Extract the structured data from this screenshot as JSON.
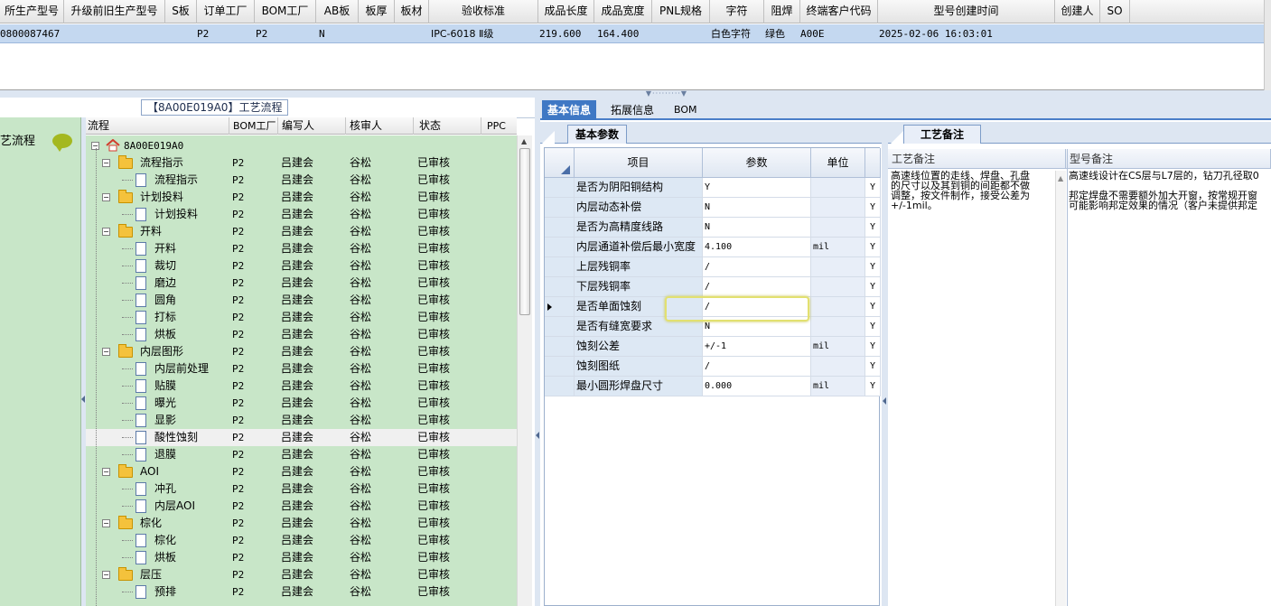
{
  "top_grid": {
    "columns": [
      "所生产型号",
      "升级前旧生产型号",
      "S板",
      "订单工厂",
      "BOM工厂",
      "AB板",
      "板厚",
      "板材",
      "验收标准",
      "成品长度",
      "成品宽度",
      "PNL规格",
      "字符",
      "阻焊",
      "终端客户代码",
      "型号创建时间",
      "创建人",
      "SO"
    ],
    "row": {
      "model": "0800087467",
      "old_model": "",
      "s_board": "",
      "order_factory": "P2",
      "bom_factory": "P2",
      "ab": "N",
      "thickness": "",
      "material": "",
      "standard": "IPC-6018 Ⅱ级",
      "length": "219.600",
      "width": "164.400",
      "pnl": "",
      "char": "白色字符",
      "mask": "绿色",
      "customer": "A00E",
      "created": "2025-02-06 16:03:01",
      "creator": "",
      "so": ""
    }
  },
  "left": {
    "title": "【8A00E019A0】工艺流程",
    "side_label": "艺流程",
    "tree_headers": [
      "流程",
      "BOM工厂",
      "编写人",
      "核审人",
      "状态",
      "PPC"
    ],
    "root": "8A00E019A0",
    "rows": [
      {
        "name": "流程指示",
        "level": 1,
        "type": "folder",
        "bom": "P2",
        "writer": "吕建会",
        "reviewer": "谷松",
        "status": "已审核"
      },
      {
        "name": "流程指示",
        "level": 2,
        "type": "doc",
        "bom": "P2",
        "writer": "吕建会",
        "reviewer": "谷松",
        "status": "已审核"
      },
      {
        "name": "计划投料",
        "level": 1,
        "type": "folder",
        "bom": "P2",
        "writer": "吕建会",
        "reviewer": "谷松",
        "status": "已审核"
      },
      {
        "name": "计划投料",
        "level": 2,
        "type": "doc",
        "bom": "P2",
        "writer": "吕建会",
        "reviewer": "谷松",
        "status": "已审核"
      },
      {
        "name": "开料",
        "level": 1,
        "type": "folder",
        "bom": "P2",
        "writer": "吕建会",
        "reviewer": "谷松",
        "status": "已审核"
      },
      {
        "name": "开料",
        "level": 2,
        "type": "doc",
        "bom": "P2",
        "writer": "吕建会",
        "reviewer": "谷松",
        "status": "已审核"
      },
      {
        "name": "裁切",
        "level": 2,
        "type": "doc",
        "bom": "P2",
        "writer": "吕建会",
        "reviewer": "谷松",
        "status": "已审核"
      },
      {
        "name": "磨边",
        "level": 2,
        "type": "doc",
        "bom": "P2",
        "writer": "吕建会",
        "reviewer": "谷松",
        "status": "已审核"
      },
      {
        "name": "圆角",
        "level": 2,
        "type": "doc",
        "bom": "P2",
        "writer": "吕建会",
        "reviewer": "谷松",
        "status": "已审核"
      },
      {
        "name": "打标",
        "level": 2,
        "type": "doc",
        "bom": "P2",
        "writer": "吕建会",
        "reviewer": "谷松",
        "status": "已审核"
      },
      {
        "name": "烘板",
        "level": 2,
        "type": "doc",
        "bom": "P2",
        "writer": "吕建会",
        "reviewer": "谷松",
        "status": "已审核"
      },
      {
        "name": "内层图形",
        "level": 1,
        "type": "folder",
        "bom": "P2",
        "writer": "吕建会",
        "reviewer": "谷松",
        "status": "已审核"
      },
      {
        "name": "内层前处理",
        "level": 2,
        "type": "doc",
        "bom": "P2",
        "writer": "吕建会",
        "reviewer": "谷松",
        "status": "已审核"
      },
      {
        "name": "贴膜",
        "level": 2,
        "type": "doc",
        "bom": "P2",
        "writer": "吕建会",
        "reviewer": "谷松",
        "status": "已审核"
      },
      {
        "name": "曝光",
        "level": 2,
        "type": "doc",
        "bom": "P2",
        "writer": "吕建会",
        "reviewer": "谷松",
        "status": "已审核"
      },
      {
        "name": "显影",
        "level": 2,
        "type": "doc",
        "bom": "P2",
        "writer": "吕建会",
        "reviewer": "谷松",
        "status": "已审核"
      },
      {
        "name": "酸性蚀刻",
        "level": 2,
        "type": "doc",
        "bom": "P2",
        "writer": "吕建会",
        "reviewer": "谷松",
        "status": "已审核",
        "selected": true
      },
      {
        "name": "退膜",
        "level": 2,
        "type": "doc",
        "bom": "P2",
        "writer": "吕建会",
        "reviewer": "谷松",
        "status": "已审核"
      },
      {
        "name": "AOI",
        "level": 1,
        "type": "folder",
        "bom": "P2",
        "writer": "吕建会",
        "reviewer": "谷松",
        "status": "已审核"
      },
      {
        "name": "冲孔",
        "level": 2,
        "type": "doc",
        "bom": "P2",
        "writer": "吕建会",
        "reviewer": "谷松",
        "status": "已审核"
      },
      {
        "name": "内层AOI",
        "level": 2,
        "type": "doc",
        "bom": "P2",
        "writer": "吕建会",
        "reviewer": "谷松",
        "status": "已审核"
      },
      {
        "name": "棕化",
        "level": 1,
        "type": "folder",
        "bom": "P2",
        "writer": "吕建会",
        "reviewer": "谷松",
        "status": "已审核"
      },
      {
        "name": "棕化",
        "level": 2,
        "type": "doc",
        "bom": "P2",
        "writer": "吕建会",
        "reviewer": "谷松",
        "status": "已审核"
      },
      {
        "name": "烘板",
        "level": 2,
        "type": "doc",
        "bom": "P2",
        "writer": "吕建会",
        "reviewer": "谷松",
        "status": "已审核"
      },
      {
        "name": "层压",
        "level": 1,
        "type": "folder",
        "bom": "P2",
        "writer": "吕建会",
        "reviewer": "谷松",
        "status": "已审核"
      },
      {
        "name": "预排",
        "level": 2,
        "type": "doc",
        "bom": "P2",
        "writer": "吕建会",
        "reviewer": "谷松",
        "status": "已审核"
      }
    ]
  },
  "right": {
    "tabs": [
      "基本信息",
      "拓展信息",
      "BOM"
    ],
    "subtab": "基本参数",
    "notes_tab": "工艺备注",
    "params_headers": [
      "项目",
      "参数",
      "单位"
    ],
    "params": [
      {
        "item": "是否为阴阳铜结构",
        "value": "Y",
        "unit": "",
        "flag": "Y"
      },
      {
        "item": "内层动态补偿",
        "value": "N",
        "unit": "",
        "flag": "Y"
      },
      {
        "item": "是否为高精度线路",
        "value": "N",
        "unit": "",
        "flag": "Y"
      },
      {
        "item": "内层通道补偿后最小宽度",
        "value": "4.100",
        "unit": "mil",
        "flag": "Y"
      },
      {
        "item": "上层残铜率",
        "value": "/",
        "unit": "",
        "flag": "Y"
      },
      {
        "item": "下层残铜率",
        "value": "/",
        "unit": "",
        "flag": "Y"
      },
      {
        "item": "是否单面蚀刻",
        "value": "/",
        "unit": "",
        "flag": "Y",
        "current": true
      },
      {
        "item": "是否有缝宽要求",
        "value": "N",
        "unit": "",
        "flag": "Y"
      },
      {
        "item": "蚀刻公差",
        "value": "+/-1",
        "unit": "mil",
        "flag": "Y"
      },
      {
        "item": "蚀刻图纸",
        "value": "/",
        "unit": "",
        "flag": "Y"
      },
      {
        "item": "最小圆形焊盘尺寸",
        "value": "0.000",
        "unit": "mil",
        "flag": "Y"
      }
    ],
    "notes_headers": [
      "工艺备注",
      "型号备注"
    ],
    "process_note": [
      "高速线位置的走线、焊盘、孔盘",
      "的尺寸以及其到铜的间距都不做",
      "调整，按文件制作，接受公差为",
      "+/-1mil。"
    ],
    "model_note": [
      "高速线设计在CS层与L7层的，钻刀孔径取0",
      "",
      "邦定焊盘不需要额外加大开窗，按常规开窗",
      "可能影响邦定效果的情况（客户未提供邦定"
    ]
  }
}
